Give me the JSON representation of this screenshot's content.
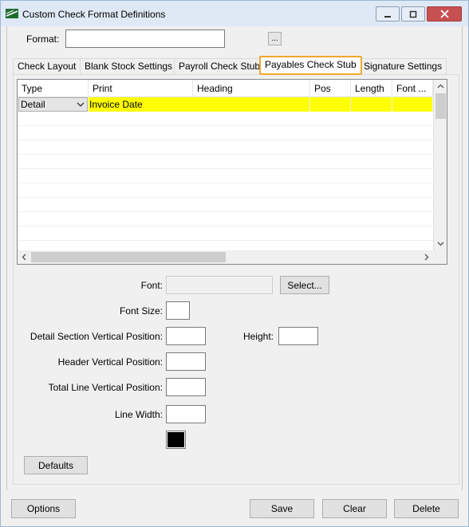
{
  "window": {
    "title": "Custom Check Format Definitions",
    "minimize_icon": "minimize-icon",
    "maximize_icon": "maximize-icon",
    "close_icon": "close-icon"
  },
  "format": {
    "label": "Format:",
    "value": "",
    "browse_label": "..."
  },
  "tabs": [
    {
      "label": "Check Layout",
      "active": false
    },
    {
      "label": "Blank Stock Settings",
      "active": false
    },
    {
      "label": "Payroll Check Stub",
      "active": false
    },
    {
      "label": "Payables Check Stub",
      "active": true
    },
    {
      "label": "Signature Settings",
      "active": false
    }
  ],
  "grid": {
    "columns": [
      "Type",
      "Print",
      "Heading",
      "Pos",
      "Length",
      "Font ..."
    ],
    "rows": [
      {
        "type": "Detail",
        "print": "Invoice Date",
        "heading": "",
        "pos": "",
        "length": "",
        "font": ""
      }
    ],
    "selected_row_color": "#ffff00"
  },
  "form": {
    "font_label": "Font:",
    "font_value": "",
    "select_button": "Select...",
    "font_size_label": "Font Size:",
    "font_size_value": "",
    "detail_pos_label": "Detail Section Vertical Position:",
    "detail_pos_value": "",
    "height_label": "Height:",
    "height_value": "",
    "header_pos_label": "Header Vertical Position:",
    "header_pos_value": "",
    "total_pos_label": "Total Line Vertical Position:",
    "total_pos_value": "",
    "line_width_label": "Line Width:",
    "line_width_value": "",
    "line_color": "#000000",
    "defaults_button": "Defaults"
  },
  "footer": {
    "options_button": "Options",
    "save_button": "Save",
    "clear_button": "Clear",
    "delete_button": "Delete"
  }
}
